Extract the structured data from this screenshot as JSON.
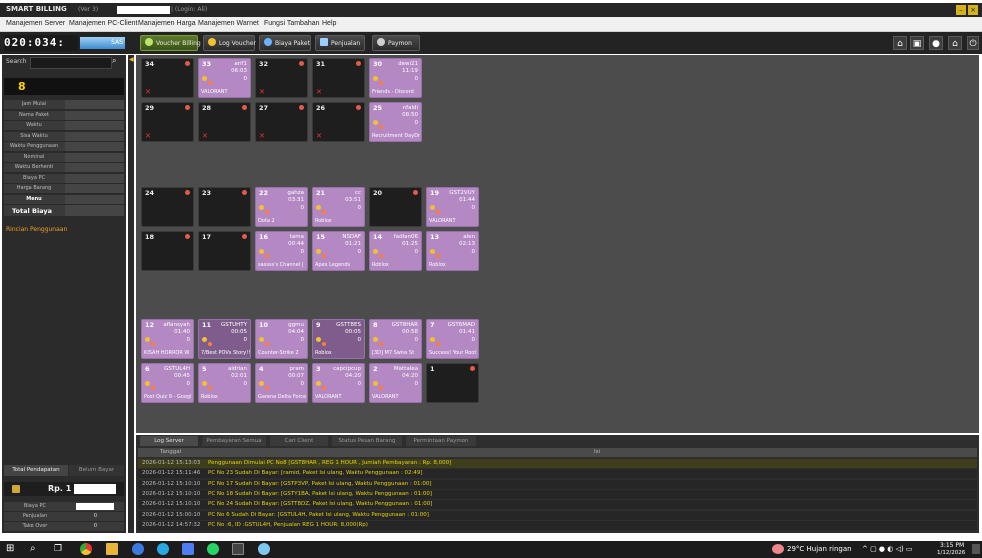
{
  "titlebar": {
    "app": "SMART BILLING",
    "version": "(Ver 3)",
    "login": "| (Login: Ali)"
  },
  "menu": [
    "Manajemen Server",
    "Manajemen PC-Client",
    "Manajemen Harga",
    "Manajemen Warnet",
    "Fungsi Tambahan",
    "Help"
  ],
  "toolbar": {
    "timer": "020:034:",
    "timer_bar": "SAS",
    "buttons": [
      "Voucher Billing",
      "Log Voucher",
      "Biaya Paket",
      "Penjualan",
      "Paymon"
    ]
  },
  "left": {
    "search_label": "Search",
    "pc_number": "8",
    "info_labels": [
      "Jam Mulai",
      "Nama Paket",
      "Waktu",
      "Sisa Waktu",
      "Waktu Penggunaan",
      "Nominal",
      "Waktu Berhenti",
      "Biaya PC",
      "Harga Barang",
      "Menu",
      "Total Biaya"
    ],
    "rincian": "Rincian Penggunaan",
    "bottom_tabs": [
      "Total Pendapatan",
      "Belum Bayar"
    ],
    "rp_prefix": "Rp. 1",
    "summary": [
      {
        "label": "Biaya PC",
        "value": ""
      },
      {
        "label": "Penjualan",
        "value": "0"
      },
      {
        "label": "Take Over",
        "value": "0"
      }
    ]
  },
  "pcs": [
    {
      "num": "34",
      "status": "off",
      "row": 0,
      "col": 0
    },
    {
      "num": "33",
      "status": "on",
      "user": "arif1",
      "time": "06:03",
      "zero": "0",
      "game": "VALORANT",
      "row": 0,
      "col": 1
    },
    {
      "num": "32",
      "status": "off",
      "row": 0,
      "col": 2
    },
    {
      "num": "31",
      "status": "off",
      "row": 0,
      "col": 3
    },
    {
      "num": "30",
      "status": "on",
      "user": "dewi21",
      "time": "11:19",
      "zero": "0",
      "game": "Friends - Discord",
      "row": 0,
      "col": 4
    },
    {
      "num": "29",
      "status": "off",
      "row": 1,
      "col": 0
    },
    {
      "num": "28",
      "status": "off",
      "row": 1,
      "col": 1
    },
    {
      "num": "27",
      "status": "off",
      "row": 1,
      "col": 2
    },
    {
      "num": "26",
      "status": "off",
      "row": 1,
      "col": 3
    },
    {
      "num": "25",
      "status": "on",
      "user": "nfaldi",
      "time": "08:50",
      "zero": "0",
      "game": "Recruitment DayDr",
      "row": 1,
      "col": 4
    },
    {
      "num": "24",
      "status": "off",
      "row": 2,
      "col": 0
    },
    {
      "num": "23",
      "status": "off",
      "row": 2,
      "col": 1
    },
    {
      "num": "22",
      "status": "on",
      "user": "gahza",
      "time": "03:31",
      "zero": "0",
      "game": "Dota 2",
      "row": 2,
      "col": 2
    },
    {
      "num": "21",
      "status": "on",
      "user": "cc",
      "time": "03:51",
      "zero": "0",
      "game": "Roblox",
      "row": 2,
      "col": 3
    },
    {
      "num": "20",
      "status": "off",
      "row": 2,
      "col": 4
    },
    {
      "num": "19",
      "status": "on",
      "user": "GST2VUY",
      "time": "01:44",
      "zero": "0",
      "game": "VALORANT",
      "row": 2,
      "col": 5
    },
    {
      "num": "18",
      "status": "off",
      "row": 3,
      "col": 0
    },
    {
      "num": "17",
      "status": "off",
      "row": 3,
      "col": 1
    },
    {
      "num": "16",
      "status": "on",
      "user": "tama",
      "time": "00:44",
      "zero": "0",
      "game": "sassss's Channel |",
      "row": 3,
      "col": 2
    },
    {
      "num": "15",
      "status": "on",
      "user": "NSDAF",
      "time": "01:21",
      "zero": "0",
      "game": "Apex Legends",
      "row": 3,
      "col": 3
    },
    {
      "num": "14",
      "status": "on",
      "user": "fadlan06",
      "time": "01:25",
      "zero": "0",
      "game": "Roblox",
      "row": 3,
      "col": 4
    },
    {
      "num": "13",
      "status": "on",
      "user": "alen",
      "time": "02:13",
      "zero": "0",
      "game": "Roblox",
      "row": 3,
      "col": 5
    },
    {
      "num": "12",
      "status": "on",
      "user": "aflansyah",
      "time": "01:40",
      "zero": "0",
      "game": "KISAH HORROR W",
      "row": 4,
      "col": 0
    },
    {
      "num": "11",
      "status": "dark",
      "user": "GSTUHTY",
      "time": "00:05",
      "zero": "0",
      "game": "7/Best POVs Story!!",
      "row": 4,
      "col": 1
    },
    {
      "num": "10",
      "status": "on",
      "user": "ggmu",
      "time": "04:04",
      "zero": "0",
      "game": "Counter-Strike 2",
      "row": 4,
      "col": 2
    },
    {
      "num": "9",
      "status": "dark",
      "user": "GSTT8ES",
      "time": "00:05",
      "zero": "0",
      "game": "Roblox",
      "row": 4,
      "col": 3
    },
    {
      "num": "8",
      "status": "on",
      "user": "GST8HAR",
      "time": "00:58",
      "zero": "0",
      "game": "[3D] M7 Swiss St",
      "row": 4,
      "col": 4
    },
    {
      "num": "7",
      "status": "on",
      "user": "GST6MAD",
      "time": "01:41",
      "zero": "0",
      "game": "Success! Your Root",
      "row": 4,
      "col": 5
    },
    {
      "num": "6",
      "status": "on",
      "user": "GSTUL4H",
      "time": "00:45",
      "zero": "0",
      "game": "Post Quiz 9 - Googl",
      "row": 5,
      "col": 0
    },
    {
      "num": "5",
      "status": "on",
      "user": "aldrian",
      "time": "02:01",
      "zero": "0",
      "game": "Roblox",
      "row": 5,
      "col": 1
    },
    {
      "num": "4",
      "status": "on",
      "user": "pram",
      "time": "00:07",
      "zero": "0",
      "game": "Garena Delta Force",
      "row": 5,
      "col": 2
    },
    {
      "num": "3",
      "status": "on",
      "user": "capcipcup",
      "time": "04:20",
      "zero": "0",
      "game": "VALORANT",
      "row": 5,
      "col": 3
    },
    {
      "num": "2",
      "status": "on",
      "user": "Mattalea",
      "time": "04:20",
      "zero": "0",
      "game": "VALORANT",
      "row": 5,
      "col": 4
    },
    {
      "num": "1",
      "status": "off",
      "row": 5,
      "col": 5
    }
  ],
  "log": {
    "tabs": [
      "Log Server",
      "Pembayaran Semua",
      "Cari Client",
      "Status Pesan Barang",
      "Permintaan Paymon"
    ],
    "headers": [
      "Tanggal",
      "Isi"
    ],
    "rows": [
      {
        "date": "2026-01-12 15:13:03",
        "msg": "Penggunaan Dimulai PC No8 [GST8HAR , REG 1 HOUR , Jumlah Pembayaran : Rp. 8,000]"
      },
      {
        "date": "2026-01-12 15:11:46",
        "msg": "PC No 23 Sudah Di Bayar: [ramid, Paket Isi ulang, Waktu Penggunaan : 02:49]"
      },
      {
        "date": "2026-01-12 15:10:10",
        "msg": "PC No 17 Sudah Di Bayar: [GSTP3VP, Paket Isi ulang, Waktu Penggunaan : 01:00]"
      },
      {
        "date": "2026-01-12 15:10:10",
        "msg": "PC No 18 Sudah Di Bayar: [GSTY1BA, Paket Isi ulang, Waktu Penggunaan : 01:00]"
      },
      {
        "date": "2026-01-12 15:10:10",
        "msg": "PC No 24 Sudah Di Bayar: [GSTT8DZ, Paket Isi ulang, Waktu Penggunaan : 01:00]"
      },
      {
        "date": "2026-01-12 15:00:10",
        "msg": "PC No 6 Sudah Di Bayar: [GSTUL4H, Paket Isi ulang, Waktu Penggunaan : 01:00]"
      },
      {
        "date": "2026-01-12 14:57:32",
        "msg": "PC No :6, ID :GSTUL4H, Penjualan REG 1 HOUR: 8,000(Rp)"
      }
    ]
  },
  "taskbar": {
    "weather": "29°C  Hujan ringan",
    "time": "3:15 PM",
    "date": "1/12/2026"
  },
  "colors": {
    "active_pc": "#b388c3",
    "log_text": "#e8d400",
    "pc_number": "#ffd400"
  }
}
